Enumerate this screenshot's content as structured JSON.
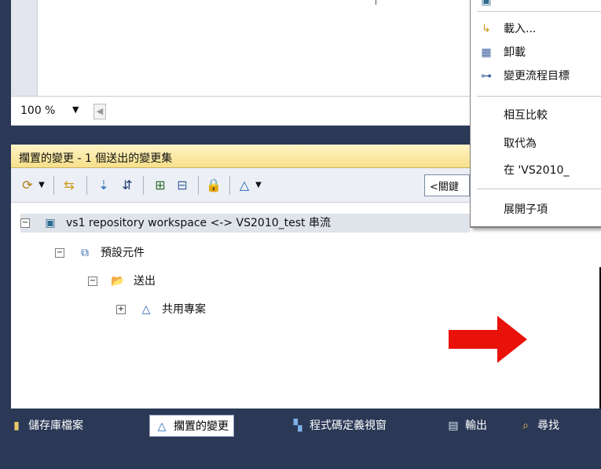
{
  "editor": {
    "zoom": "100 %",
    "zoom_dropdown_icon": "caret-down",
    "scroll_left_icon": "chevron-left"
  },
  "panel": {
    "title": "擱置的變更 - 1 個送出的變更集",
    "filter_text": "<關鍵"
  },
  "toolbar": {
    "icons": [
      "refresh-dropdown",
      "swap-icon",
      "accept-icon",
      "flow-icon",
      "add-icon",
      "collapse-icon",
      "lock-icon",
      "delta-dropdown"
    ]
  },
  "tree": {
    "nodes": [
      {
        "label": "vs1 repository workspace <-> VS2010_test 串流",
        "level": 0,
        "icon": "workspace-icon"
      },
      {
        "label": "預設元件",
        "level": 1,
        "icon": "component-icon"
      },
      {
        "label": "送出",
        "level": 2,
        "icon": "folder-out-icon"
      },
      {
        "label": "共用專案",
        "level": 3,
        "icon": "delta-icon"
      }
    ]
  },
  "context_menu": {
    "items": [
      {
        "label": "載入...",
        "icon": "load-icon"
      },
      {
        "label": "卸載",
        "icon": "unload-icon"
      },
      {
        "label": "變更流程目標",
        "icon": "flow-target-icon"
      },
      {
        "label": "相互比較",
        "icon": ""
      },
      {
        "label": "取代為",
        "icon": ""
      },
      {
        "label": "在 'VS2010_",
        "icon": ""
      },
      {
        "label": "展開子項",
        "icon": ""
      }
    ]
  },
  "tabs": [
    {
      "label": "儲存庫檔案",
      "icon": "repo-files-icon",
      "active": false
    },
    {
      "label": "擱置的變更",
      "icon": "delta-icon",
      "active": true
    },
    {
      "label": "程式碼定義視窗",
      "icon": "code-def-icon",
      "active": false
    },
    {
      "label": "輸出",
      "icon": "output-icon",
      "active": false
    },
    {
      "label": "尋找",
      "icon": "search-icon",
      "active": false
    }
  ],
  "colors": {
    "chrome": "#2b3856",
    "panel_title": "#f7e08a",
    "arrow": "#e8120a"
  }
}
